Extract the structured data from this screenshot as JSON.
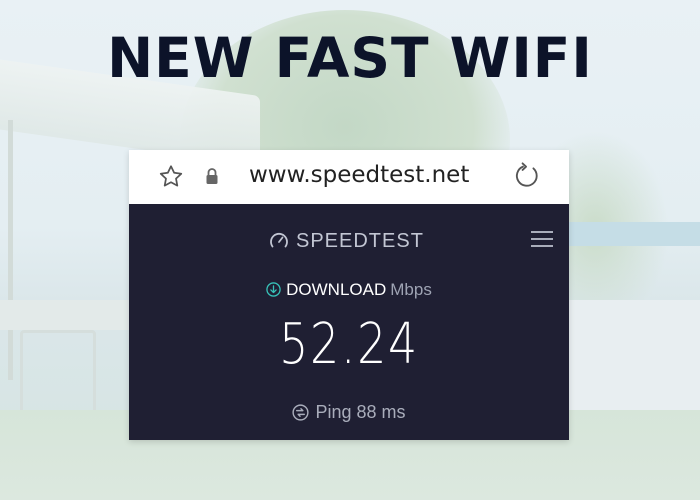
{
  "headline": "NEW FAST WIFI",
  "browser": {
    "url": "www.speedtest.net",
    "icons": [
      "star-icon",
      "lock-icon",
      "reload-icon"
    ]
  },
  "app": {
    "logo_text": "SPEEDTEST",
    "icons": [
      "gauge-icon",
      "hamburger-menu-icon",
      "download-arrow-icon",
      "ping-icon"
    ]
  },
  "result": {
    "download_label": "DOWNLOAD",
    "unit": "Mbps",
    "download_value": "52.24",
    "ping_text": "Ping 88 ms"
  },
  "colors": {
    "headline": "#0c1329",
    "panel": "#1f1f33",
    "accent_cyan": "#37c1b8",
    "muted_text": "#a9adbb"
  }
}
